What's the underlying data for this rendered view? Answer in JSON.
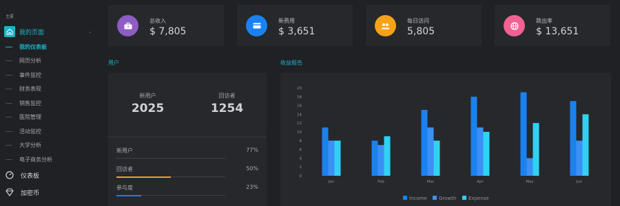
{
  "sidebar": {
    "section_label": "主要",
    "main_item": {
      "label": "我的页面",
      "chevron": "⌄"
    },
    "sub_items": [
      {
        "label": "我的仪表板"
      },
      {
        "label": "网页分析"
      },
      {
        "label": "事件监控"
      },
      {
        "label": "财务表现"
      },
      {
        "label": "销售监控"
      },
      {
        "label": "医院管理"
      },
      {
        "label": "活动监控"
      },
      {
        "label": "大学分析"
      },
      {
        "label": "电子商务分析"
      }
    ],
    "bottom_items": [
      {
        "label": "仪表板",
        "icon": "gauge-icon"
      },
      {
        "label": "加密币",
        "icon": "diamond-icon"
      }
    ]
  },
  "stats": [
    {
      "title": "总收入",
      "value": "$ 7,805",
      "icon": "briefcase-icon",
      "color": "#8e5cc4"
    },
    {
      "title": "新费用",
      "value": "$ 3,651",
      "icon": "credit-card-icon",
      "color": "#1a82f0"
    },
    {
      "title": "每日访问",
      "value": "5,805",
      "icon": "users-icon",
      "color": "#f5a21a"
    },
    {
      "title": "跳出率",
      "value": "$ 13,651",
      "icon": "globe-icon",
      "color": "#f06292"
    }
  ],
  "users": {
    "section_title": "用户",
    "new_users_label": "新用户",
    "new_users_value": "2025",
    "returning_label": "回访者",
    "returning_value": "1254",
    "progress": [
      {
        "label": "新用户",
        "value": "77%",
        "fraction": 0.0,
        "color": "#8e9297"
      },
      {
        "label": "回访者",
        "value": "50%",
        "fraction": 0.5,
        "color": "#f5a21a"
      },
      {
        "label": "参与度",
        "value": "23%",
        "fraction": 0.23,
        "color": "#1a82f0"
      }
    ]
  },
  "revenue": {
    "section_title": "收益报告"
  },
  "chart_data": {
    "type": "bar",
    "categories": [
      "Jan",
      "Feb",
      "Mar",
      "Apr",
      "May",
      "Jun"
    ],
    "series": [
      {
        "name": "Income",
        "values": [
          11,
          8,
          15,
          18,
          19,
          17
        ],
        "color": "#1a82f0"
      },
      {
        "name": "Growth",
        "values": [
          8,
          7,
          11,
          11,
          4,
          8
        ],
        "color": "#3c8ff5"
      },
      {
        "name": "Expense",
        "values": [
          8,
          9,
          8,
          10,
          12,
          14
        ],
        "color": "#2ed2f2"
      }
    ],
    "ylim": [
      0,
      20
    ],
    "yticks": [
      "0",
      "2",
      "4",
      "6",
      "8",
      "10",
      "12",
      "14",
      "16",
      "18",
      "20"
    ],
    "legend_position": "bottom",
    "grid": false
  }
}
